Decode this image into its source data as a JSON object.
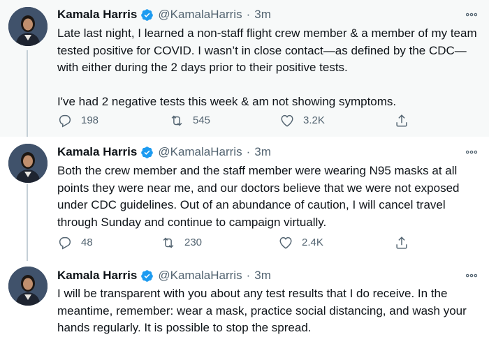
{
  "tweets": [
    {
      "name": "Kamala Harris",
      "handle": "@KamalaHarris",
      "time": "3m",
      "text": "Late last night, I learned a non-staff flight crew member & a member of my team tested positive for COVID. I wasn’t in close contact—as defined by the CDC—with either during the 2 days prior to their positive tests.\n\nI've had 2 negative tests this week & am not showing symptoms.",
      "replies": "198",
      "retweets": "545",
      "likes": "3.2K"
    },
    {
      "name": "Kamala Harris",
      "handle": "@KamalaHarris",
      "time": "3m",
      "text": "Both the crew member and the staff member were wearing N95 masks at all points they were near me, and our doctors believe that we were not exposed under CDC guidelines. Out of an abundance of caution, I will cancel travel through Sunday and continue to campaign virtually.",
      "replies": "48",
      "retweets": "230",
      "likes": "2.4K"
    },
    {
      "name": "Kamala Harris",
      "handle": "@KamalaHarris",
      "time": "3m",
      "text": "I will be transparent with you about any test results that I do receive. In the meantime, remember: wear a mask, practice social distancing, and wash your hands regularly. It is possible to stop the spread."
    }
  ],
  "separator": "·",
  "colors": {
    "verified": "#1d9bf0",
    "secondary_text": "#536471",
    "thread_line": "#c4cfd6"
  },
  "icons": [
    "verified-badge-icon",
    "more-options-icon",
    "reply-icon",
    "retweet-icon",
    "like-icon",
    "share-icon"
  ]
}
